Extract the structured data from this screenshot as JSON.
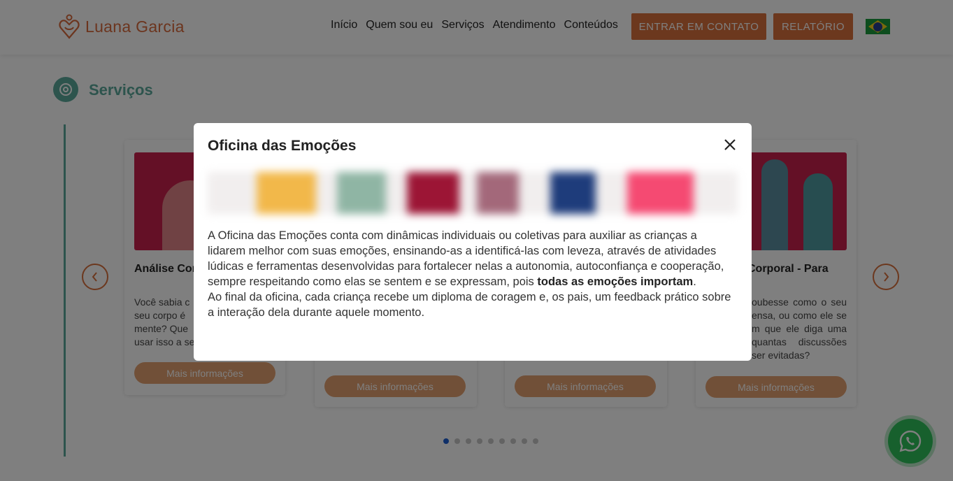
{
  "header": {
    "logo_text": "Luana Garcia",
    "nav": [
      "Início",
      "Quem sou eu",
      "Serviços",
      "Atendimento",
      "Conteúdos"
    ],
    "contact_button": "ENTRAR EM CONTATO",
    "report_button": "RELATÓRIO",
    "language_flag": "brazil-flag-icon"
  },
  "section": {
    "title": "Serviços"
  },
  "cards": [
    {
      "title": "Análise Cor    Individual",
      "text": "Você sabia c seu corpo é mente? Que usar isso a se",
      "button": "Mais informações"
    },
    {
      "button": "Mais informações"
    },
    {
      "button": "Mais informações"
    },
    {
      "title": "Corporal - Para",
      "text": "oubesse como o seu ensa, ou como ele se m que ele diga uma quantas discussões ser evitadas?",
      "button": "Mais informações"
    }
  ],
  "carousel": {
    "prev_icon": "chevron-left-icon",
    "next_icon": "chevron-right-icon",
    "dots_total": 9,
    "active_dot": 1
  },
  "modal": {
    "title": "Oficina das Emoções",
    "paragraph1_part1": "A Oficina das Emoções conta com dinâmicas individuais ou coletivas para auxiliar as crianças a lidarem melhor com suas emoções, ensinando-as a identificá-las com leveza, através de atividades lúdicas e ferramentas desenvolvidas para fortalecer nelas a autonomia, autoconfiança e cooperação, sempre respeitando como elas se sentem e se expressam, pois ",
    "paragraph1_bold": "todas as emoções importam",
    "paragraph1_end": ".",
    "paragraph2": "Ao final da oficina, cada criança recebe um diploma de coragem e, os pais, um feedback prático sobre a interação dela durante aquele momento.",
    "close_icon": "close-icon"
  },
  "colors": {
    "brand_orange": "#d8703d",
    "brand_teal": "#5aa89b",
    "whatsapp_green": "#2fc15a"
  }
}
